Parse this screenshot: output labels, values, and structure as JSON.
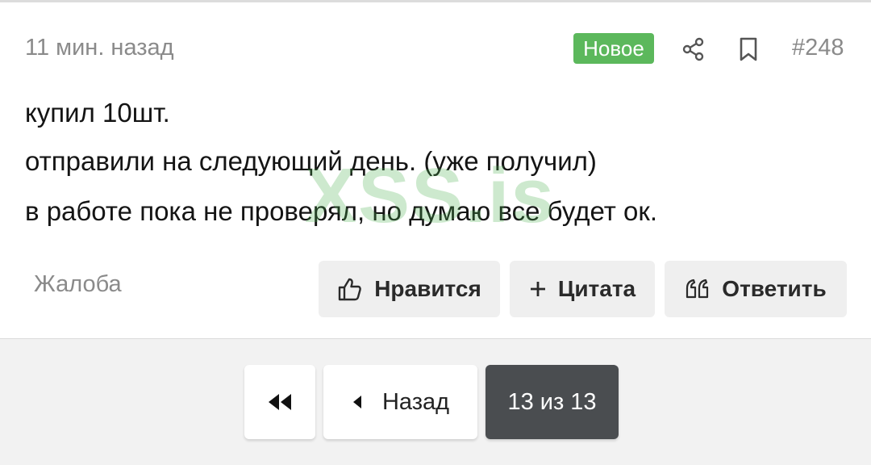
{
  "post": {
    "timestamp": "11 мин. назад",
    "badge": "Новое",
    "number": "#248",
    "lines": [
      "купил 10шт.",
      "отправили на следующий день. (уже получил)",
      "в работе пока не проверял, но думаю все будет ок."
    ],
    "watermark": "XSS.is",
    "complaint": "Жалоба",
    "actions": {
      "like": "Нравится",
      "quote": "Цитата",
      "reply": "Ответить"
    }
  },
  "pagination": {
    "prev_label": "Назад",
    "current": "13 из 13"
  },
  "icons": [
    "share-icon",
    "bookmark-icon",
    "thumbs-up-icon",
    "plus-icon",
    "quote-icon",
    "double-left-icon",
    "caret-left-icon"
  ],
  "colors": {
    "badge": "#5cb85c",
    "current_page": "#4a4d50",
    "muted_text": "#8a8a8a"
  }
}
